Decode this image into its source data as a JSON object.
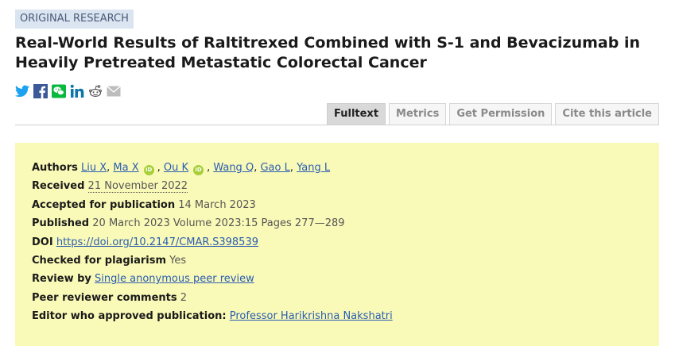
{
  "article": {
    "type_badge": "ORIGINAL RESEARCH",
    "title": "Real-World Results of Raltitrexed Combined with S-1 and Bevacizumab in Heavily Pretreated Metastatic Colorectal Cancer"
  },
  "share_icons": [
    "twitter-icon",
    "facebook-icon",
    "wechat-icon",
    "linkedin-icon",
    "reddit-icon",
    "email-icon"
  ],
  "tabs": [
    {
      "label": "Fulltext",
      "active": true
    },
    {
      "label": "Metrics",
      "active": false
    },
    {
      "label": "Get Permission",
      "active": false
    },
    {
      "label": "Cite this article",
      "active": false
    }
  ],
  "meta": {
    "authors_label": "Authors",
    "authors": [
      "Liu X",
      "Ma X",
      "Ou K",
      "Wang Q",
      "Gao L",
      "Yang L"
    ],
    "received_label": "Received",
    "received": "21 November 2022",
    "accepted_label": "Accepted for publication",
    "accepted": "14 March 2023",
    "published_label": "Published",
    "published": "20 March 2023 Volume 2023:15 Pages 277—289",
    "doi_label": "DOI",
    "doi": "https://doi.org/10.2147/CMAR.S398539",
    "plagiarism_label": "Checked for plagiarism",
    "plagiarism": "Yes",
    "review_label": "Review by",
    "review": "Single anonymous peer review",
    "comments_label": "Peer reviewer comments",
    "comments": "2",
    "editor_label": "Editor who approved publication:",
    "editor": "Professor Harikrishna Nakshatri"
  },
  "colors": {
    "badge_bg": "#dbe5f1",
    "meta_bg": "#fafab8",
    "link": "#2a5db0",
    "orcid": "#a6ce39",
    "twitter": "#1da1f2",
    "facebook": "#3b5998",
    "wechat": "#09b83e",
    "linkedin": "#0e76a8"
  }
}
